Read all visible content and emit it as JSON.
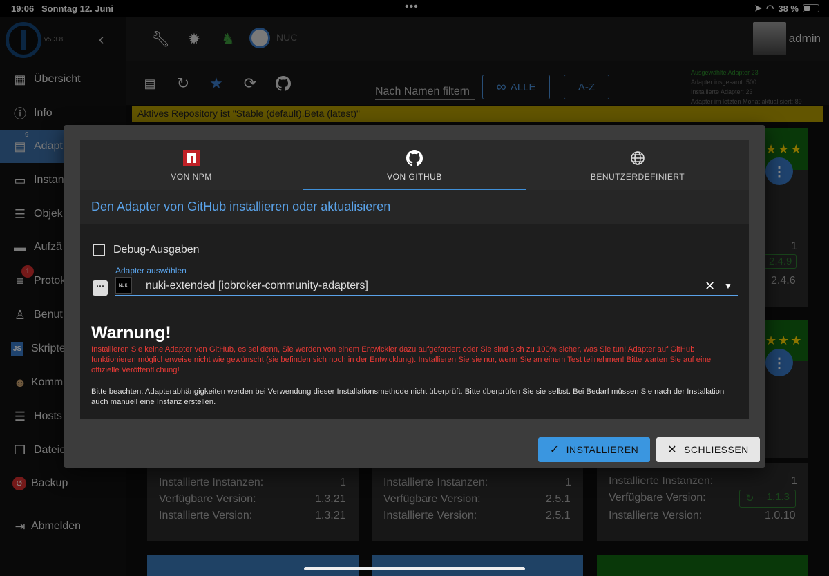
{
  "status_bar": {
    "time": "19:06",
    "date": "Sonntag 12. Juni",
    "battery": "38 %"
  },
  "sidebar": {
    "version": "v5.3.8",
    "items": [
      {
        "label": "Übersicht",
        "icon": "grid-icon"
      },
      {
        "label": "Info",
        "icon": "info-icon"
      },
      {
        "label": "Adapt",
        "icon": "store-icon",
        "badge": "9"
      },
      {
        "label": "Instan",
        "icon": "instances-icon"
      },
      {
        "label": "Objek",
        "icon": "list-icon"
      },
      {
        "label": "Aufzä",
        "icon": "enum-icon"
      },
      {
        "label": "Protok",
        "icon": "log-icon",
        "badge": "1"
      },
      {
        "label": "Benut",
        "icon": "user-icon"
      },
      {
        "label": "Skripte",
        "icon": "js-icon"
      },
      {
        "label": "Komm",
        "icon": "person-icon"
      },
      {
        "label": "Hosts",
        "icon": "hosts-icon"
      },
      {
        "label": "Dateie",
        "icon": "file-icon"
      },
      {
        "label": "Backup",
        "icon": "backup-icon"
      },
      {
        "label": "Abmelden",
        "icon": "logout-icon"
      }
    ]
  },
  "topbar": {
    "host": "NUC",
    "user": "admin"
  },
  "adapters_toolbar": {
    "filter_label": "Nach Namen filtern",
    "all_button": "ALLE",
    "az_button": "A-Z",
    "stats": [
      "Ausgewählte Adapter 23",
      "Adapter insgesamt: 500",
      "Installierte Adapter: 23",
      "Adapter im letzten Monat aktualisiert: 89"
    ],
    "repo_notice": "Aktives Repository ist \"Stable (default),Beta (latest)\""
  },
  "cards": {
    "right_top": {
      "installed_count": "1",
      "available": "2.4.9",
      "installed": "2.4.6"
    },
    "bottom": [
      {
        "inst_label": "Installierte Instanzen:",
        "inst_value": "1",
        "avail_label": "Verfügbare Version:",
        "avail_value": "1.3.21",
        "installed_label": "Installierte Version:",
        "installed_value": "1.3.21"
      },
      {
        "inst_label": "Installierte Instanzen:",
        "inst_value": "1",
        "avail_label": "Verfügbare Version:",
        "avail_value": "2.5.1",
        "installed_label": "Installierte Version:",
        "installed_value": "2.5.1"
      },
      {
        "inst_label": "Installierte Instanzen:",
        "inst_value": "1",
        "avail_label": "Verfügbare Version:",
        "avail_value": "1.1.3",
        "installed_label": "Installierte Version:",
        "installed_value": "1.0.10"
      }
    ]
  },
  "dialog": {
    "tabs": [
      {
        "label": "VON NPM",
        "icon": "npm-icon"
      },
      {
        "label": "VON GITHUB",
        "icon": "github-icon",
        "selected": true
      },
      {
        "label": "BENUTZERDEFINIERT",
        "icon": "globe-icon"
      }
    ],
    "title": "Den Adapter von GitHub installieren oder aktualisieren",
    "debug_label": "Debug-Ausgaben",
    "select_caption": "Adapter auswählen",
    "select_value": "nuki-extended [iobroker-community-adapters]",
    "nuki_logo_text": "NUKI",
    "warning_title": "Warnung!",
    "warning_text": "Installieren Sie keine Adapter von GitHub, es sei denn, Sie werden von einem Entwickler dazu aufgefordert oder Sie sind sich zu 100% sicher, was Sie tun! Adapter auf GitHub funktionieren möglicherweise nicht wie gewünscht (sie befinden sich noch in der Entwicklung). Installieren Sie sie nur, wenn Sie an einem Test teilnehmen! Bitte warten Sie auf eine offizielle Veröffentlichung!",
    "note_text": "Bitte beachten: Adapterabhängigkeiten werden bei Verwendung dieser Installationsmethode nicht überprüft. Bitte überprüfen Sie sie selbst. Bei Bedarf müssen Sie nach der Installation auch manuell eine Instanz erstellen.",
    "install_button": "INSTALLIEREN",
    "close_button": "SCHLIESSEN"
  },
  "colors": {
    "accent": "#3a96e0",
    "warning": "#e53935",
    "repo_bar": "#b39b00",
    "card_header": "#116611"
  }
}
